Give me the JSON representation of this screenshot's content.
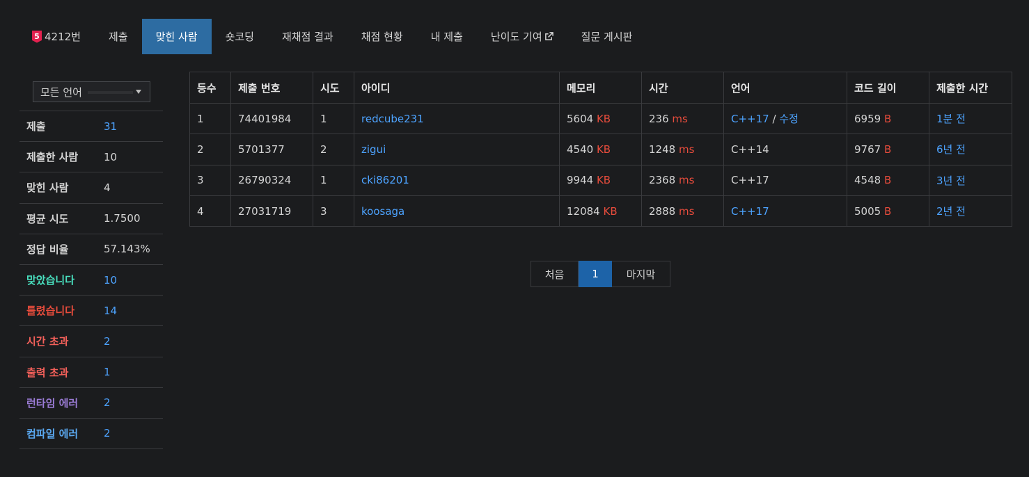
{
  "nav": {
    "tier_number": "5",
    "problem": "4212번",
    "items": [
      {
        "label": "제출"
      },
      {
        "label": "맞힌 사람"
      },
      {
        "label": "숏코딩"
      },
      {
        "label": "재채점 결과"
      },
      {
        "label": "채점 현황"
      },
      {
        "label": "내 제출"
      },
      {
        "label": "난이도 기여"
      },
      {
        "label": "질문 게시판"
      }
    ],
    "active_index": 1
  },
  "sidebar": {
    "language_select": "모든 언어",
    "stats": [
      {
        "label": "제출",
        "value": "31",
        "label_color": "#d4d4d4",
        "value_color": "#4da3ff"
      },
      {
        "label": "제출한 사람",
        "value": "10",
        "label_color": "#d4d4d4",
        "value_color": "#d4d4d4"
      },
      {
        "label": "맞힌 사람",
        "value": "4",
        "label_color": "#d4d4d4",
        "value_color": "#d4d4d4"
      },
      {
        "label": "평균 시도",
        "value": "1.7500",
        "label_color": "#d4d4d4",
        "value_color": "#d4d4d4"
      },
      {
        "label": "정답 비율",
        "value": "57.143%",
        "label_color": "#d4d4d4",
        "value_color": "#d4d4d4"
      },
      {
        "label": "맞았습니다",
        "value": "10",
        "label_color": "#49e1c0",
        "value_color": "#4da3ff"
      },
      {
        "label": "틀렸습니다",
        "value": "14",
        "label_color": "#e74c3c",
        "value_color": "#4da3ff"
      },
      {
        "label": "시간 초과",
        "value": "2",
        "label_color": "#f4605a",
        "value_color": "#4da3ff"
      },
      {
        "label": "출력 초과",
        "value": "1",
        "label_color": "#f4605a",
        "value_color": "#4da3ff"
      },
      {
        "label": "런타임 에러",
        "value": "2",
        "label_color": "#9b7cd6",
        "value_color": "#4da3ff"
      },
      {
        "label": "컴파일 에러",
        "value": "2",
        "label_color": "#5aa8f0",
        "value_color": "#4da3ff"
      }
    ]
  },
  "table": {
    "headers": [
      "등수",
      "제출 번호",
      "시도",
      "아이디",
      "메모리",
      "시간",
      "언어",
      "코드 길이",
      "제출한 시간"
    ],
    "memory_unit": "KB",
    "time_unit": "ms",
    "length_unit": "B",
    "rows": [
      {
        "rank": "1",
        "submission": "74401984",
        "tries": "1",
        "user": "redcube231",
        "memory": "5604",
        "time": "236",
        "language": "C++17",
        "language_link": true,
        "edit": "수정",
        "length": "6959",
        "submitted": "1분 전"
      },
      {
        "rank": "2",
        "submission": "5701377",
        "tries": "2",
        "user": "zigui",
        "memory": "4540",
        "time": "1248",
        "language": "C++14",
        "language_link": false,
        "edit": "",
        "length": "9767",
        "submitted": "6년 전"
      },
      {
        "rank": "3",
        "submission": "26790324",
        "tries": "1",
        "user": "cki86201",
        "memory": "9944",
        "time": "2368",
        "language": "C++17",
        "language_link": false,
        "edit": "",
        "length": "4548",
        "submitted": "3년 전"
      },
      {
        "rank": "4",
        "submission": "27031719",
        "tries": "3",
        "user": "koosaga",
        "memory": "12084",
        "time": "2888",
        "language": "C++17",
        "language_link": true,
        "edit": "",
        "length": "5005",
        "submitted": "2년 전"
      }
    ]
  },
  "pagination": {
    "first": "처음",
    "current": "1",
    "last": "마지막"
  }
}
